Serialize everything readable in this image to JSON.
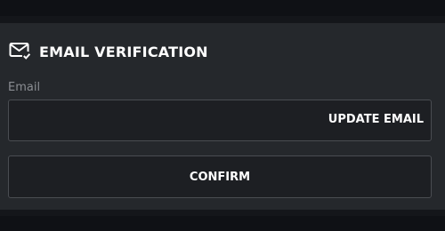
{
  "header": {
    "icon": "mail-check-icon",
    "title": "EMAIL VERIFICATION"
  },
  "email_field": {
    "label": "Email",
    "value": "",
    "update_label": "UPDATE EMAIL"
  },
  "confirm_button": {
    "label": "CONFIRM"
  },
  "colors": {
    "background": "#14161a",
    "panel": "#25282c",
    "input_bg": "#1d1f23",
    "border": "#4a4d52",
    "text": "#ffffff",
    "muted": "#8a8d92"
  }
}
